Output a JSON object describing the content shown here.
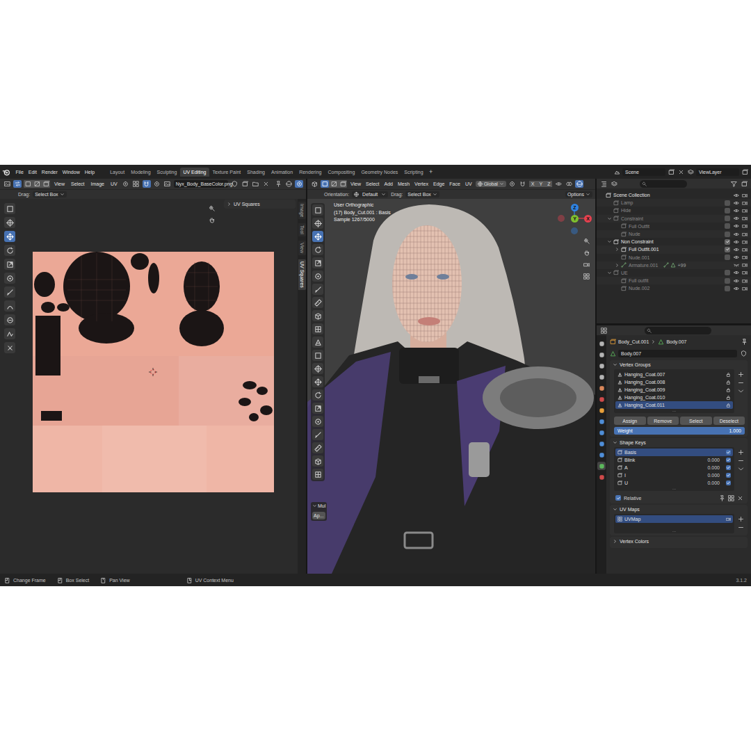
{
  "topbar": {
    "menus": [
      "File",
      "Edit",
      "Render",
      "Window",
      "Help"
    ],
    "workspaces": [
      {
        "label": "Layout",
        "selected": false
      },
      {
        "label": "Modeling",
        "selected": false
      },
      {
        "label": "Sculpting",
        "selected": false
      },
      {
        "label": "UV Editing",
        "selected": true
      },
      {
        "label": "Texture Paint",
        "selected": false
      },
      {
        "label": "Shading",
        "selected": false
      },
      {
        "label": "Animation",
        "selected": false
      },
      {
        "label": "Rendering",
        "selected": false
      },
      {
        "label": "Compositing",
        "selected": false
      },
      {
        "label": "Geometry Nodes",
        "selected": false
      },
      {
        "label": "Scripting",
        "selected": false
      }
    ],
    "add_workspace": "+",
    "scene": "Scene",
    "view_layer": "ViewLayer"
  },
  "uv_editor": {
    "sync_selection": true,
    "menus": [
      "View",
      "Select",
      "Image",
      "UV"
    ],
    "image_name": "Nyx_Body_BaseColor.png",
    "drag_label": "Drag:",
    "drag_value": "Select Box",
    "panel_title": "UV Squares",
    "panel_expanded": false,
    "side_tabs": [
      {
        "label": "Image",
        "selected": false
      },
      {
        "label": "Tool",
        "selected": false
      },
      {
        "label": "View",
        "selected": false
      },
      {
        "label": "UV Squares",
        "selected": true
      }
    ],
    "tools": [
      {
        "selected": false
      },
      {
        "selected": false
      },
      {
        "selected": true
      },
      {
        "selected": false
      },
      {
        "selected": false
      },
      {
        "selected": false
      },
      {
        "selected": false
      },
      {
        "selected": false
      },
      {
        "selected": false
      },
      {
        "selected": false
      },
      {
        "selected": false
      }
    ]
  },
  "viewport": {
    "select_modes": [
      {
        "selected": true
      },
      {
        "selected": false
      },
      {
        "selected": false
      }
    ],
    "menus": [
      "View",
      "Select",
      "Add",
      "Mesh",
      "Vertex",
      "Edge",
      "Face",
      "UV"
    ],
    "transform_orientation": "Global",
    "axis_locks": [
      "X",
      "Y",
      "Z"
    ],
    "orientation_label": "Orientation:",
    "orientation_value": "Default",
    "drag_label": "Drag:",
    "drag_value": "Select Box",
    "options": "Options",
    "info": [
      "User Orthographic",
      "(17) Body_Cut.001 : Basis",
      "Sample 1267/5000"
    ],
    "gizmo": [
      {
        "label": "Z",
        "color": "#2f83e3"
      },
      {
        "label": "Y",
        "color": "#7fbf2f"
      },
      {
        "label": "X",
        "color": "#e4414f"
      }
    ],
    "last_operator": "Mul",
    "last_operator_expanded": true,
    "apply_button": "Ap...",
    "tools": [
      {
        "selected": false
      },
      {
        "selected": false
      },
      {
        "selected": true
      },
      {
        "selected": false
      },
      {
        "selected": false
      },
      {
        "selected": false
      },
      {
        "selected": false
      },
      {
        "selected": false
      },
      {
        "selected": false
      },
      {
        "selected": false
      },
      {
        "selected": false
      },
      {
        "selected": false
      },
      {
        "selected": false
      },
      {
        "selected": false
      },
      {
        "selected": false
      },
      {
        "selected": false
      },
      {
        "selected": false
      },
      {
        "selected": false
      },
      {
        "selected": false
      },
      {
        "selected": false
      },
      {
        "selected": false
      }
    ]
  },
  "outliner": {
    "rows": [
      {
        "label": "Scene Collection",
        "depth": 0,
        "kind": "scene",
        "expanded": null,
        "checked": null,
        "visible": true,
        "dimmed": false
      },
      {
        "label": "Lamp",
        "depth": 1,
        "kind": "collection",
        "expanded": null,
        "checked": false,
        "visible": true,
        "dimmed": true
      },
      {
        "label": "Hide",
        "depth": 1,
        "kind": "collection",
        "expanded": null,
        "checked": false,
        "visible": true,
        "dimmed": true
      },
      {
        "label": "Constraint",
        "depth": 1,
        "kind": "collection",
        "expanded": true,
        "checked": false,
        "visible": true,
        "dimmed": true
      },
      {
        "label": "Full Outfit",
        "depth": 2,
        "kind": "collection",
        "expanded": null,
        "checked": false,
        "visible": true,
        "dimmed": true
      },
      {
        "label": "Nude",
        "depth": 2,
        "kind": "collection",
        "expanded": null,
        "checked": false,
        "visible": true,
        "dimmed": true
      },
      {
        "label": "Non Constraint",
        "depth": 1,
        "kind": "collection",
        "expanded": true,
        "checked": true,
        "visible": true,
        "dimmed": false
      },
      {
        "label": "Full Outfit.001",
        "depth": 2,
        "kind": "collection",
        "expanded": false,
        "checked": true,
        "visible": true,
        "dimmed": false
      },
      {
        "label": "Nude.001",
        "depth": 2,
        "kind": "collection",
        "expanded": null,
        "checked": false,
        "visible": true,
        "dimmed": true
      },
      {
        "label": "Armature.001",
        "depth": 2,
        "kind": "armature",
        "expanded": false,
        "checked": null,
        "visible": false,
        "dimmed": true,
        "badge": "+99"
      },
      {
        "label": "UE",
        "depth": 1,
        "kind": "collection",
        "expanded": true,
        "checked": false,
        "visible": true,
        "dimmed": true
      },
      {
        "label": "Full outfit",
        "depth": 2,
        "kind": "collection",
        "expanded": null,
        "checked": false,
        "visible": true,
        "dimmed": true
      },
      {
        "label": "Nude.002",
        "depth": 2,
        "kind": "collection",
        "expanded": null,
        "checked": false,
        "visible": true,
        "dimmed": true
      }
    ]
  },
  "properties": {
    "tabs": [
      {
        "selected": false,
        "color": "#b4b4b4"
      },
      {
        "selected": false,
        "color": "#b4b4b4"
      },
      {
        "selected": false,
        "color": "#b4b4b4"
      },
      {
        "selected": false,
        "color": "#b4b4b4"
      },
      {
        "selected": false,
        "color": "#d9875a"
      },
      {
        "selected": false,
        "color": "#cf4a4a"
      },
      {
        "selected": false,
        "color": "#e8a03a"
      },
      {
        "selected": false,
        "color": "#4f8ed8"
      },
      {
        "selected": false,
        "color": "#4f8ed8"
      },
      {
        "selected": false,
        "color": "#4f8ed8"
      },
      {
        "selected": false,
        "color": "#4f8ed8"
      },
      {
        "selected": true,
        "color": "#5cb85c"
      },
      {
        "selected": false,
        "color": "#cf4a4a"
      }
    ],
    "breadcrumb": [
      "Body_Cut.001",
      "Body.007"
    ],
    "data_name": "Body.007",
    "vertex_groups": {
      "title": "Vertex Groups",
      "expanded": true,
      "items": [
        {
          "label": "Hanging_Coat.007",
          "selected": false
        },
        {
          "label": "Hanging_Coat.008",
          "selected": false
        },
        {
          "label": "Hanging_Coat.009",
          "selected": false
        },
        {
          "label": "Hanging_Coat.010",
          "selected": false
        },
        {
          "label": "Hanging_Coat.011",
          "selected": true
        }
      ],
      "buttons": [
        "Assign",
        "Remove",
        "Select",
        "Deselect"
      ],
      "weight_label": "Weight",
      "weight_value": "1.000",
      "weight_level": 1
    },
    "shape_keys": {
      "title": "Shape Keys",
      "expanded": true,
      "items": [
        {
          "label": "Basis",
          "value": null,
          "checked": true,
          "selected": true
        },
        {
          "label": "Blink",
          "value": "0.000",
          "checked": true,
          "selected": false
        },
        {
          "label": "A",
          "value": "0.000",
          "checked": true,
          "selected": false
        },
        {
          "label": "I",
          "value": "0.000",
          "checked": true,
          "selected": false
        },
        {
          "label": "U",
          "value": "0.000",
          "checked": true,
          "selected": false
        }
      ],
      "relative_label": "Relative",
      "relative_checked": true
    },
    "uv_maps": {
      "title": "UV Maps",
      "expanded": true,
      "items": [
        {
          "label": "UVMap",
          "selected": true
        }
      ]
    },
    "vertex_colors": {
      "title": "Vertex Colors",
      "expanded": false
    }
  },
  "status_bar": {
    "items": [
      "Change Frame",
      "Box Select",
      "Pan View",
      "UV Context Menu"
    ],
    "version": "3.1.2"
  }
}
